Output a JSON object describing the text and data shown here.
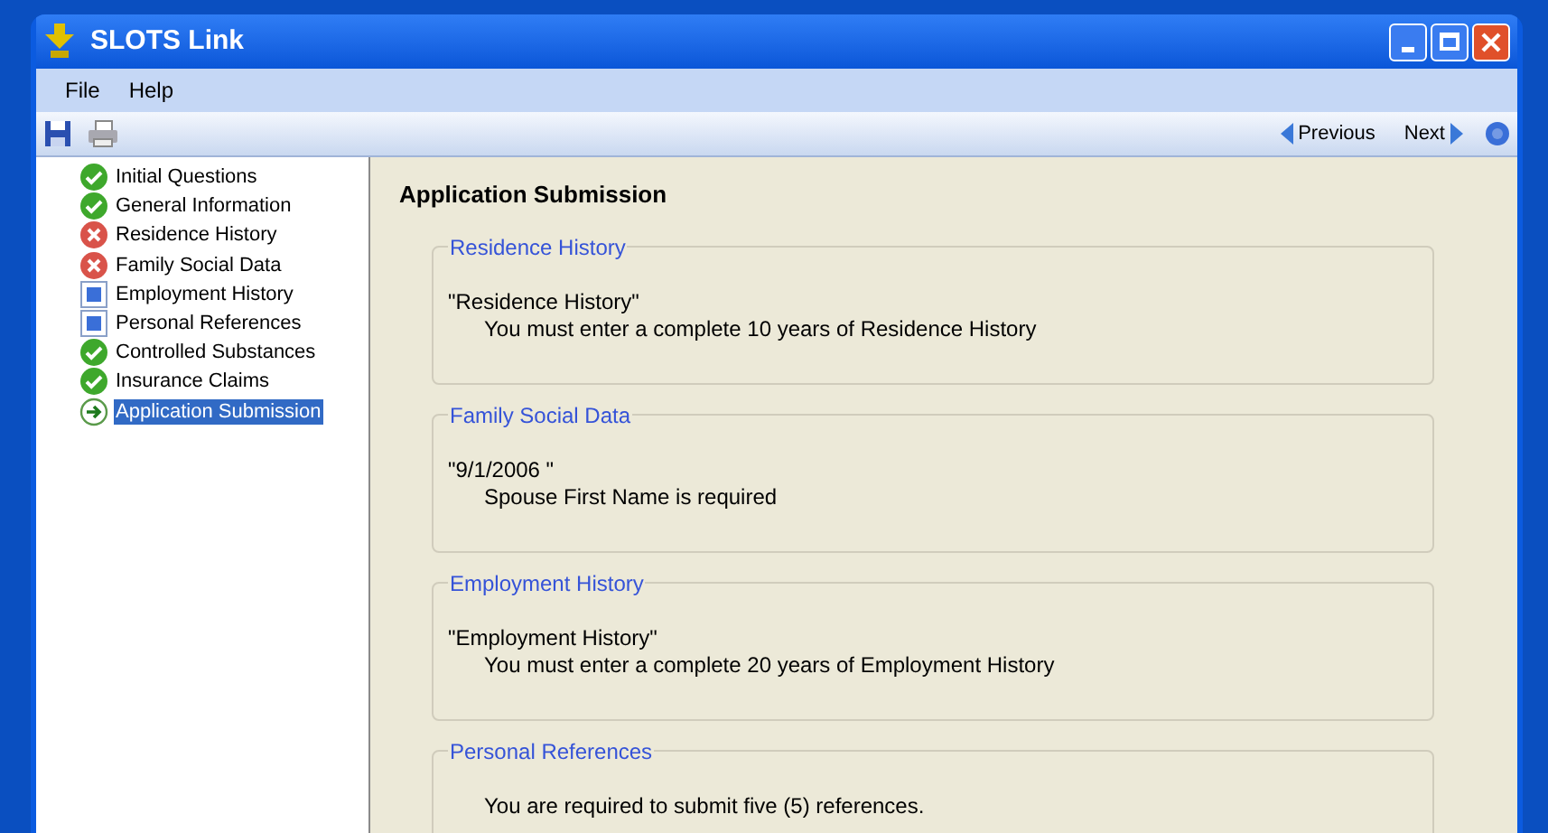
{
  "window": {
    "title": "SLOTS Link"
  },
  "menu": [
    "File",
    "Help"
  ],
  "toolbar": {
    "previous": "Previous",
    "next": "Next"
  },
  "tree": [
    {
      "label": "Initial Questions",
      "kind": "done",
      "selected": false
    },
    {
      "label": "General Information",
      "kind": "done",
      "selected": false
    },
    {
      "label": "Residence History",
      "kind": "error",
      "selected": false
    },
    {
      "label": "Family Social Data",
      "kind": "error",
      "selected": false
    },
    {
      "label": "Employment History",
      "kind": "pending",
      "selected": false
    },
    {
      "label": "Personal References",
      "kind": "pending",
      "selected": false
    },
    {
      "label": "Controlled Substances",
      "kind": "done",
      "selected": false
    },
    {
      "label": "Insurance Claims",
      "kind": "done",
      "selected": false
    },
    {
      "label": "Application Submission",
      "kind": "current",
      "selected": true
    }
  ],
  "content": {
    "title": "Application Submission",
    "sections": [
      {
        "legend": "Residence History",
        "subject": "\"Residence History\"",
        "message": "You must enter a complete 10 years of Residence History"
      },
      {
        "legend": "Family Social Data",
        "subject": "\"9/1/2006 \"",
        "message": "Spouse First Name is required"
      },
      {
        "legend": "Employment History",
        "subject": "\"Employment History\"",
        "message": "You must enter a complete 20 years of Employment History"
      },
      {
        "legend": "Personal References",
        "message": "You are required to submit five (5) references."
      }
    ]
  }
}
